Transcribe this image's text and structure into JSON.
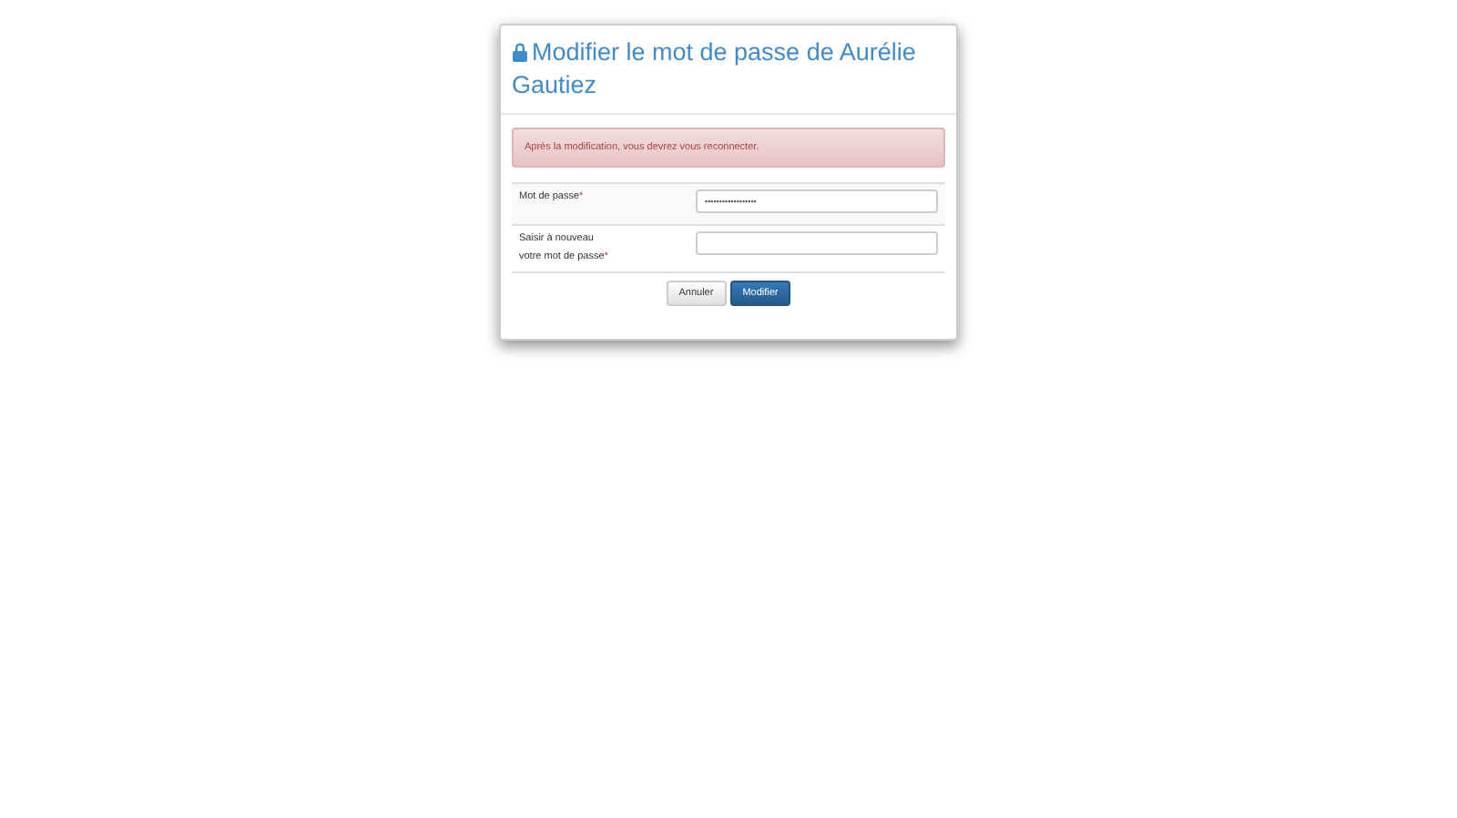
{
  "dialog": {
    "title": "Modifier le mot de passe de Aurélie Gautiez",
    "alert": "Après la modification, vous devrez vous reconnecter.",
    "fields": [
      {
        "label_lines": [
          "Mot de passe"
        ],
        "mark": "*",
        "value": "••••••••••••••••••"
      },
      {
        "label_lines": [
          "Saisir à nouveau",
          "votre mot de passe"
        ],
        "mark": "*"
      }
    ],
    "buttons": [
      {
        "label": "Annuler",
        "kind": "default"
      },
      {
        "label": "Modifier",
        "kind": "primary"
      }
    ]
  }
}
